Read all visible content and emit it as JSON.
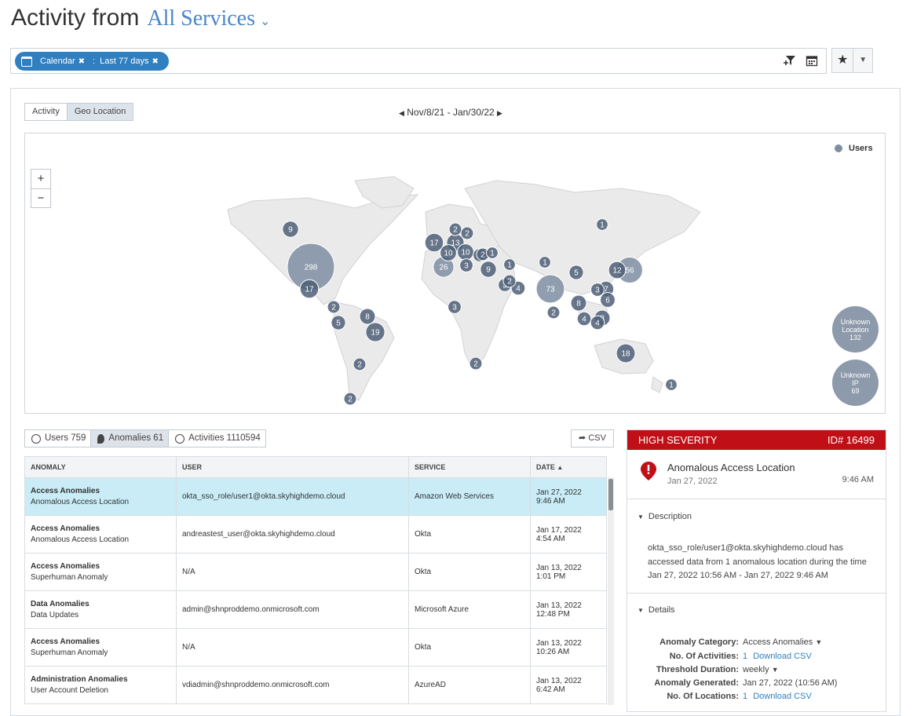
{
  "header": {
    "title": "Activity from",
    "service": "All Services"
  },
  "filter": {
    "chip_calendar": "Calendar",
    "chip_range": "Last 77 days"
  },
  "view": {
    "tabs": [
      "Activity",
      "Geo Location"
    ],
    "active_tab": "Geo Location",
    "date_range": "Nov/8/21 - Jan/30/22"
  },
  "map": {
    "legend": "Users",
    "zoom_in": "+",
    "zoom_out": "−",
    "unknown_location": {
      "line1": "Unknown",
      "line2": "Location",
      "count": "132"
    },
    "unknown_ip": {
      "line1": "Unknown",
      "line2": "IP",
      "count": "69"
    },
    "bubbles": [
      {
        "label": "298",
        "value": 298
      },
      {
        "label": "73",
        "value": 73
      },
      {
        "label": "56",
        "value": 56
      },
      {
        "label": "26",
        "value": 26
      },
      {
        "label": "19",
        "value": 19
      },
      {
        "label": "18",
        "value": 18
      },
      {
        "label": "17",
        "value": 17
      },
      {
        "label": "17",
        "value": 17
      },
      {
        "label": "13",
        "value": 13
      },
      {
        "label": "12",
        "value": 12
      },
      {
        "label": "10",
        "value": 10
      },
      {
        "label": "10",
        "value": 10
      },
      {
        "label": "9",
        "value": 9
      },
      {
        "label": "9",
        "value": 9
      },
      {
        "label": "8",
        "value": 8
      },
      {
        "label": "8",
        "value": 8
      },
      {
        "label": "8",
        "value": 8
      },
      {
        "label": "7",
        "value": 7
      },
      {
        "label": "6",
        "value": 6
      },
      {
        "label": "5",
        "value": 5
      },
      {
        "label": "5",
        "value": 5
      },
      {
        "label": "4",
        "value": 4
      },
      {
        "label": "4",
        "value": 4
      },
      {
        "label": "4",
        "value": 4
      },
      {
        "label": "3",
        "value": 3
      },
      {
        "label": "3",
        "value": 3
      },
      {
        "label": "3",
        "value": 3
      },
      {
        "label": "3",
        "value": 3
      },
      {
        "label": "3",
        "value": 3
      },
      {
        "label": "2",
        "value": 2
      },
      {
        "label": "2",
        "value": 2
      },
      {
        "label": "2",
        "value": 2
      },
      {
        "label": "2",
        "value": 2
      },
      {
        "label": "2",
        "value": 2
      },
      {
        "label": "2",
        "value": 2
      },
      {
        "label": "2",
        "value": 2
      },
      {
        "label": "2",
        "value": 2
      },
      {
        "label": "2",
        "value": 2
      },
      {
        "label": "1",
        "value": 1
      },
      {
        "label": "1",
        "value": 1
      },
      {
        "label": "1",
        "value": 1
      },
      {
        "label": "1",
        "value": 1
      },
      {
        "label": "1",
        "value": 1
      }
    ]
  },
  "lower_tabs": {
    "users": "Users 759",
    "anomalies": "Anomalies 61",
    "activities": "Activities 1110594"
  },
  "csv_button": "CSV",
  "table": {
    "columns": [
      "ANOMALY",
      "USER",
      "SERVICE",
      "DATE"
    ],
    "rows": [
      {
        "category": "Access Anomalies",
        "type": "Anomalous Access Location",
        "user": "okta_sso_role/user1@okta.skyhighdemo.cloud",
        "service": "Amazon Web Services",
        "date": "Jan 27, 2022",
        "time": "9:46 AM"
      },
      {
        "category": "Access Anomalies",
        "type": "Anomalous Access Location",
        "user": "andreastest_user@okta.skyhighdemo.cloud",
        "service": "Okta",
        "date": "Jan 17, 2022",
        "time": "4:54 AM"
      },
      {
        "category": "Access Anomalies",
        "type": "Superhuman Anomaly",
        "user": "N/A",
        "service": "Okta",
        "date": "Jan 13, 2022",
        "time": "1:01 PM"
      },
      {
        "category": "Data Anomalies",
        "type": "Data Updates",
        "user": "admin@shnproddemo.onmicrosoft.com",
        "service": "Microsoft Azure",
        "date": "Jan 13, 2022",
        "time": "12:48 PM"
      },
      {
        "category": "Access Anomalies",
        "type": "Superhuman Anomaly",
        "user": "N/A",
        "service": "Okta",
        "date": "Jan 13, 2022",
        "time": "10:26 AM"
      },
      {
        "category": "Administration Anomalies",
        "type": "User Account Deletion",
        "user": "vdiadmin@shnproddemo.onmicrosoft.com",
        "service": "AzureAD",
        "date": "Jan 13, 2022",
        "time": "6:42 AM"
      }
    ]
  },
  "detail": {
    "severity": "HIGH SEVERITY",
    "id": "ID# 16499",
    "title": "Anomalous Access Location",
    "date": "Jan 27, 2022",
    "time": "9:46 AM",
    "description_label": "Description",
    "description": "okta_sso_role/user1@okta.skyhighdemo.cloud has accessed data from 1 anomalous location during the time Jan 27, 2022 10:56 AM - Jan 27, 2022 9:46 AM",
    "details_label": "Details",
    "fields": {
      "anomaly_category_k": "Anomaly Category:",
      "anomaly_category_v": "Access Anomalies",
      "activities_k": "No. Of Activities:",
      "activities_v": "1",
      "activities_link": "Download CSV",
      "threshold_k": "Threshold Duration:",
      "threshold_v": "weekly",
      "generated_k": "Anomaly Generated:",
      "generated_v": "Jan 27, 2022 (10:56 AM)",
      "locations_k": "No. Of Locations:",
      "locations_v": "1",
      "locations_link": "Download CSV"
    }
  },
  "colors": {
    "accent": "#2f7fc1",
    "severity": "#c00f16",
    "bubble": "#7f8ea1",
    "bubble_dark": "#3e4f66",
    "selected_row": "#c9ecf7"
  }
}
